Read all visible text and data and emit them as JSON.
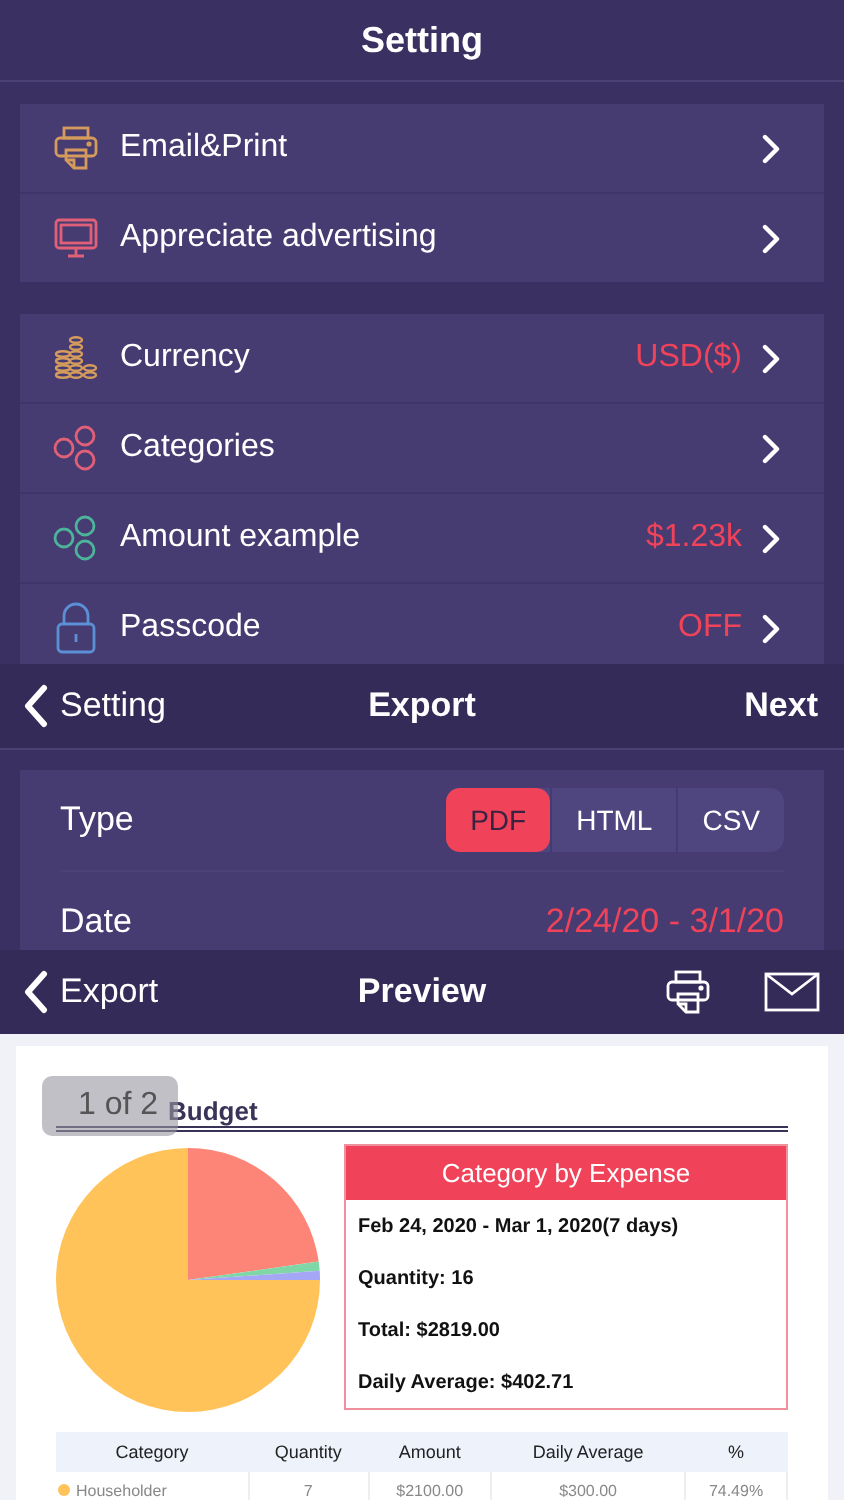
{
  "settings": {
    "title": "Setting",
    "groups": [
      {
        "rows": [
          {
            "label": "Email&Print"
          },
          {
            "label": "Appreciate advertising"
          }
        ]
      },
      {
        "rows": [
          {
            "label": "Currency",
            "value": "USD($)"
          },
          {
            "label": "Categories"
          },
          {
            "label": "Amount example",
            "value": "$1.23k"
          },
          {
            "label": "Passcode",
            "value": "OFF"
          }
        ]
      }
    ]
  },
  "export": {
    "back": "Setting",
    "title": "Export",
    "action": "Next",
    "type_label": "Type",
    "types": [
      {
        "label": "PDF",
        "selected": true
      },
      {
        "label": "HTML",
        "selected": false
      },
      {
        "label": "CSV",
        "selected": false
      }
    ],
    "date_label": "Date",
    "date_value": "2/24/20 - 3/1/20"
  },
  "preview": {
    "back": "Export",
    "title": "Preview",
    "document": {
      "title": "Budget",
      "page_indicator": "1 of 2",
      "summary": {
        "heading": "Category by Expense",
        "lines": [
          "Feb 24, 2020 - Mar 1, 2020(7 days)",
          "Quantity: 16",
          "Total: $2819.00",
          "Daily Average: $402.71"
        ]
      },
      "table": {
        "columns": [
          "Category",
          "Quantity",
          "Amount",
          "Daily Average",
          "%"
        ],
        "rows": [
          {
            "cells": [
              "Householder",
              "7",
              "$2100.00",
              "$300.00",
              "74.49%"
            ],
            "color": "#ffc35a"
          }
        ]
      }
    }
  }
}
